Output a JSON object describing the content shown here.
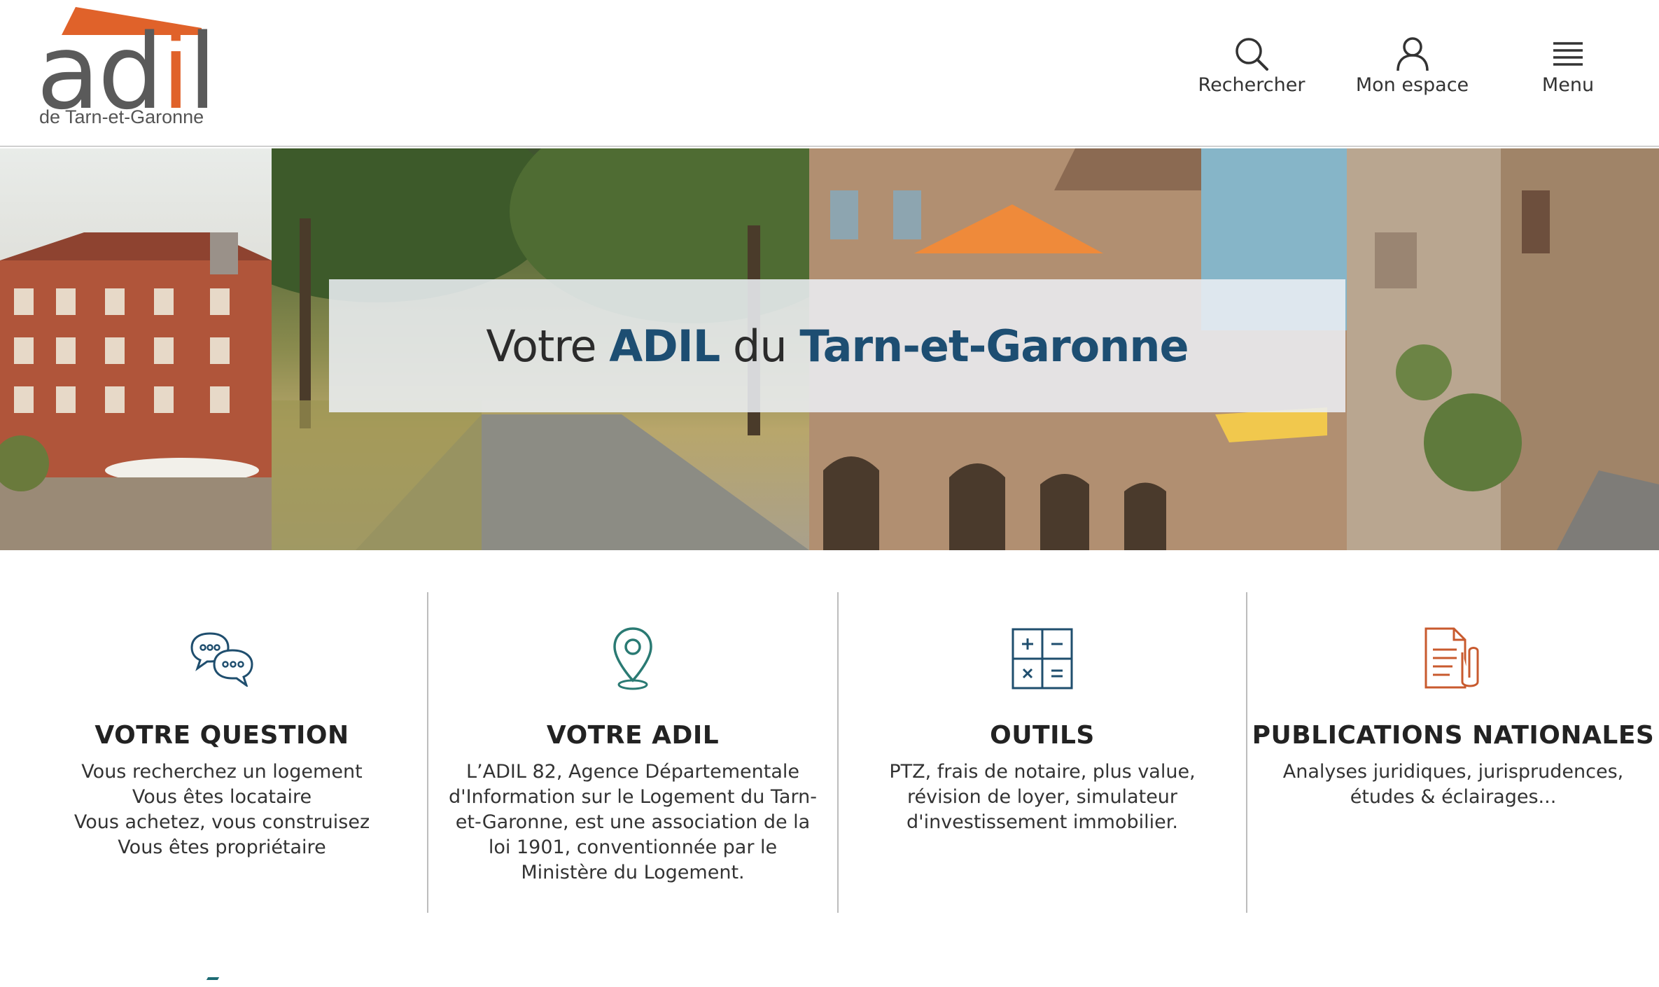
{
  "brand": {
    "logo_word_a": "ad",
    "logo_word_i": "i",
    "logo_word_l": "l",
    "logo_subtitle": "de Tarn-et-Garonne"
  },
  "header_nav": {
    "search": {
      "label": "Rechercher",
      "icon": "search-icon"
    },
    "account": {
      "label": "Mon espace",
      "icon": "user-icon"
    },
    "menu": {
      "label": "Menu",
      "icon": "hamburger-icon"
    }
  },
  "hero": {
    "title_part1": "Votre ",
    "title_highlight1": "ADIL",
    "title_part2": " du ",
    "title_highlight2": "Tarn-et-Garonne"
  },
  "features": [
    {
      "title": "VOTRE QUESTION",
      "icon": "chat-bubbles-icon",
      "lines": [
        "Vous recherchez un logement",
        "Vous êtes locataire",
        "Vous achetez, vous construisez",
        "Vous êtes propriétaire"
      ]
    },
    {
      "title": "VOTRE ADIL",
      "icon": "location-pin-icon",
      "text": "L’ADIL 82, Agence Départementale d'Information sur le Logement du Tarn-et-Garonne, est une association de la loi 1901, conventionnée par le Ministère du Logement."
    },
    {
      "title": "OUTILS",
      "icon": "calculator-icon",
      "text": "PTZ, frais de notaire, plus value, révision de loyer, simulateur d'investissement immobilier."
    },
    {
      "title": "PUBLICATIONS NATIONALES",
      "icon": "document-attachment-icon",
      "text": "Analyses juridiques, jurisprudences, études & éclairages..."
    }
  ],
  "colors": {
    "brand_orange": "#e0622a",
    "brand_grey": "#5a5a5a",
    "heading_blue": "#1d4e72",
    "icon_blue": "#1f4e6e",
    "icon_teal": "#2a7a73",
    "icon_orange": "#c85a2e"
  }
}
